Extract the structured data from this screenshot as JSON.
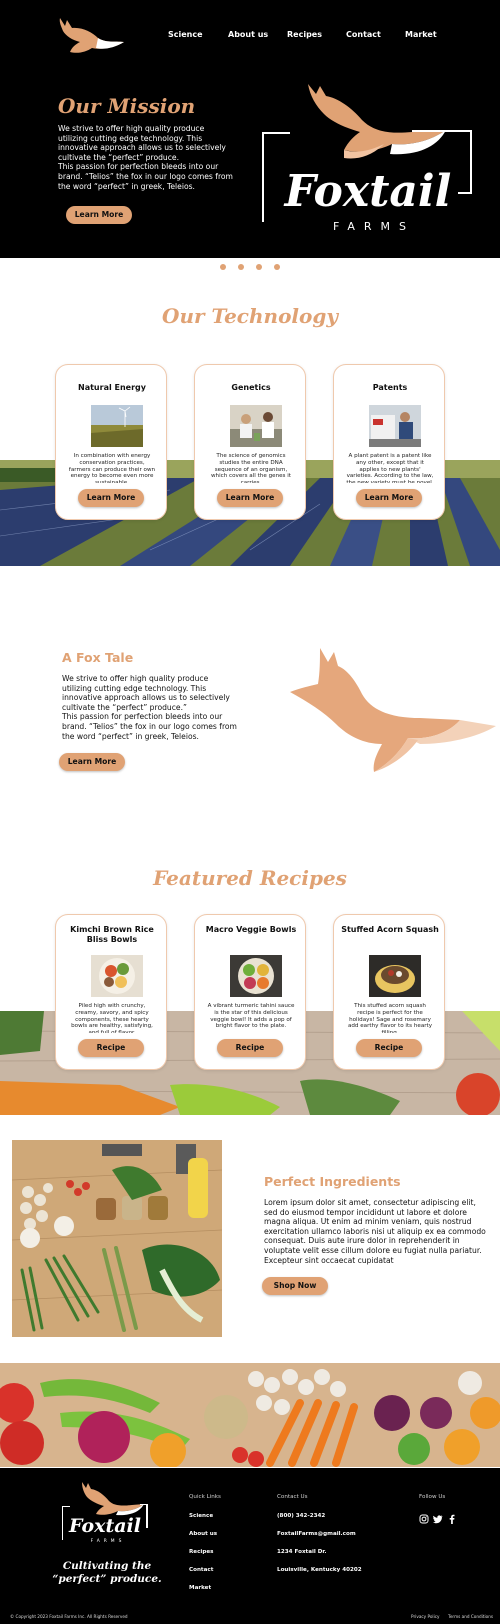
{
  "brand": {
    "name": "Foxtail",
    "sub": "FARMS",
    "accent_color": "#e0a274",
    "dark_color": "#000000"
  },
  "nav": {
    "items": [
      "Science",
      "About us",
      "Recipes",
      "Contact",
      "Market"
    ]
  },
  "hero": {
    "title": "Our Mission",
    "text": "We strive to offer high quality produce utilizing cutting edge technology. This innovative approach allows us to selectively cultivate the “perfect” produce.\nThis passion for perfection bleeds into our brand. “Telios” the fox in our logo comes from the word “perfect” in greek, Teleios.",
    "button": "Learn More",
    "carousel_slides": 4
  },
  "technology": {
    "title": "Our Technology",
    "cards": [
      {
        "title": "Natural Energy",
        "text": "In combination with energy conservation practices, farmers can produce their own energy to become even more sustainable.",
        "button": "Learn More",
        "image": "field-photo"
      },
      {
        "title": "Genetics",
        "text": "The science of genomics studies the entire DNA sequence of an organism, which covers all the genes it carries.",
        "button": "Learn More",
        "image": "lab-photo"
      },
      {
        "title": "Patents",
        "text": "A plant patent is a patent like any other, except that it applies to new plants' varieties. According to the law, the new variety must be novel.",
        "button": "Learn More",
        "image": "research-photo"
      }
    ]
  },
  "fox_tale": {
    "title": "A Fox Tale",
    "text": "We strive to offer high quality produce utilizing cutting edge technology. This innovative approach allows us to selectively cultivate the “perfect” produce.”\nThis passion for perfection bleeds into our brand. “Telios” the fox in our logo comes from the word “perfect” in greek, Teleios.",
    "button": "Learn More"
  },
  "recipes": {
    "title": "Featured Recipes",
    "cards": [
      {
        "title": "Kimchi Brown Rice Bliss Bowls",
        "text": "Piled high with crunchy, creamy, savory, and spicy components, these hearty bowls are healthy, satisfying, and full of flavor.",
        "button": "Recipe",
        "image": "kimchi-bowl-photo"
      },
      {
        "title": "Macro Veggie Bowls",
        "text": "A vibrant turmeric tahini sauce is the star of this delicious veggie bowl! It adds a pop of bright flavor to the plate.",
        "button": "Recipe",
        "image": "veggie-bowl-photo"
      },
      {
        "title": "Stuffed Acorn Squash",
        "text": "This stuffed acorn squash recipe is perfect for the holidays! Sage and rosemary add earthy flavor to its hearty filling.",
        "button": "Recipe",
        "image": "squash-photo"
      }
    ]
  },
  "ingredients": {
    "title": "Perfect Ingredients",
    "text": "Lorem ipsum dolor sit amet, consectetur adipiscing elit, sed do eiusmod tempor incididunt ut labore et dolore magna aliqua. Ut enim ad minim veniam, quis nostrud exercitation ullamco laboris nisi ut aliquip ex ea commodo consequat. Duis aute irure dolor in reprehenderit in voluptate velit esse cillum dolore eu fugiat nulla pariatur. Excepteur sint occaecat cupidatat",
    "button": "Shop Now"
  },
  "footer": {
    "slogan": "Cultivating the “perfect” produce.",
    "quick_links_heading": "Quick Links",
    "quick_links": [
      "Science",
      "About us",
      "Recipes",
      "Contact",
      "Market"
    ],
    "contact_heading": "Contact Us",
    "phone": "(800) 342-2342",
    "email": "FoxtailFarms@gmail.com",
    "address1": "1234 Foxtail Dr.",
    "address2": "Louisville, Kentucky 40202",
    "follow_heading": "Follow Us",
    "social_icons": [
      "instagram-icon",
      "twitter-icon",
      "facebook-icon"
    ],
    "copyright": "© Copyright 2023 Foxtail Farms Inc. All Rights Reserved",
    "privacy": "Privacy Policy",
    "terms": "Terms and Conditions"
  }
}
